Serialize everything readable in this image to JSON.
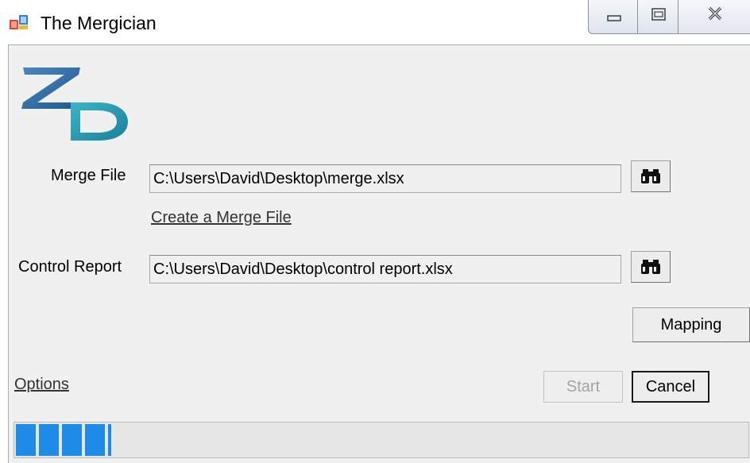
{
  "window": {
    "title": "The Mergician",
    "app_icon": "window-app-icon",
    "minimize_icon": "minimize-icon",
    "maximize_icon": "maximize-icon",
    "close_icon": "close-icon"
  },
  "logo": {
    "icon": "zd-logo",
    "colors": {
      "z": "#2f6fa6",
      "d": "#2a9fb4"
    }
  },
  "merge_file": {
    "label": "Merge File",
    "value": "C:\\Users\\David\\Desktop\\merge.xlsx",
    "browse_icon": "binoculars-icon",
    "create_link": "Create a Merge File"
  },
  "control_report": {
    "label": "Control Report",
    "value": "C:\\Users\\David\\Desktop\\control report.xlsx",
    "browse_icon": "binoculars-icon"
  },
  "buttons": {
    "mapping": "Mapping",
    "start": "Start",
    "start_enabled": false,
    "cancel": "Cancel"
  },
  "options_link": "Options",
  "progress": {
    "fraction": 0.13,
    "color": "#1e8be6"
  }
}
